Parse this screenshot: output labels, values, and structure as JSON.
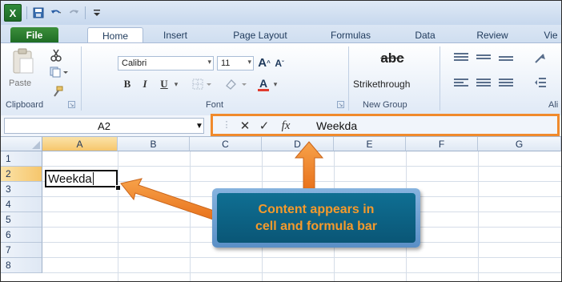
{
  "app": {
    "logo_letter": "X"
  },
  "qat": {
    "icons": [
      "save-icon",
      "undo-icon",
      "redo-icon",
      "customize-qat-icon"
    ]
  },
  "tabs": [
    {
      "label": "File"
    },
    {
      "label": "Home"
    },
    {
      "label": "Insert"
    },
    {
      "label": "Page Layout"
    },
    {
      "label": "Formulas"
    },
    {
      "label": "Data"
    },
    {
      "label": "Review"
    },
    {
      "label": "Vie"
    }
  ],
  "ribbon": {
    "clipboard": {
      "label": "Clipboard",
      "paste_label": "Paste"
    },
    "font": {
      "label": "Font",
      "font_name": "Calibri",
      "font_size": "11",
      "bold": "B",
      "italic": "I",
      "underline": "U",
      "grow": "A",
      "shrink": "A",
      "font_color": "A"
    },
    "new_group": {
      "label": "New Group",
      "button_label": "Strikethrough",
      "icon_text": "abc"
    },
    "alignment": {
      "label": "Ali"
    }
  },
  "formula_bar": {
    "name_box": "A2",
    "cancel": "✕",
    "enter": "✓",
    "fx": "fx",
    "content": "Weekda"
  },
  "sheet": {
    "columns": [
      "A",
      "B",
      "C",
      "D",
      "E",
      "F",
      "G"
    ],
    "rows": [
      "1",
      "2",
      "3",
      "4",
      "5",
      "6",
      "7",
      "8"
    ],
    "active_cell": "A2",
    "active_cell_value": "Weekda"
  },
  "callout": {
    "line1": "Content appears in",
    "line2": "cell and formula bar"
  },
  "colors": {
    "accent": "#f08a2c",
    "callout_bg": "#0a5676",
    "excel_green": "#1f6d25"
  }
}
